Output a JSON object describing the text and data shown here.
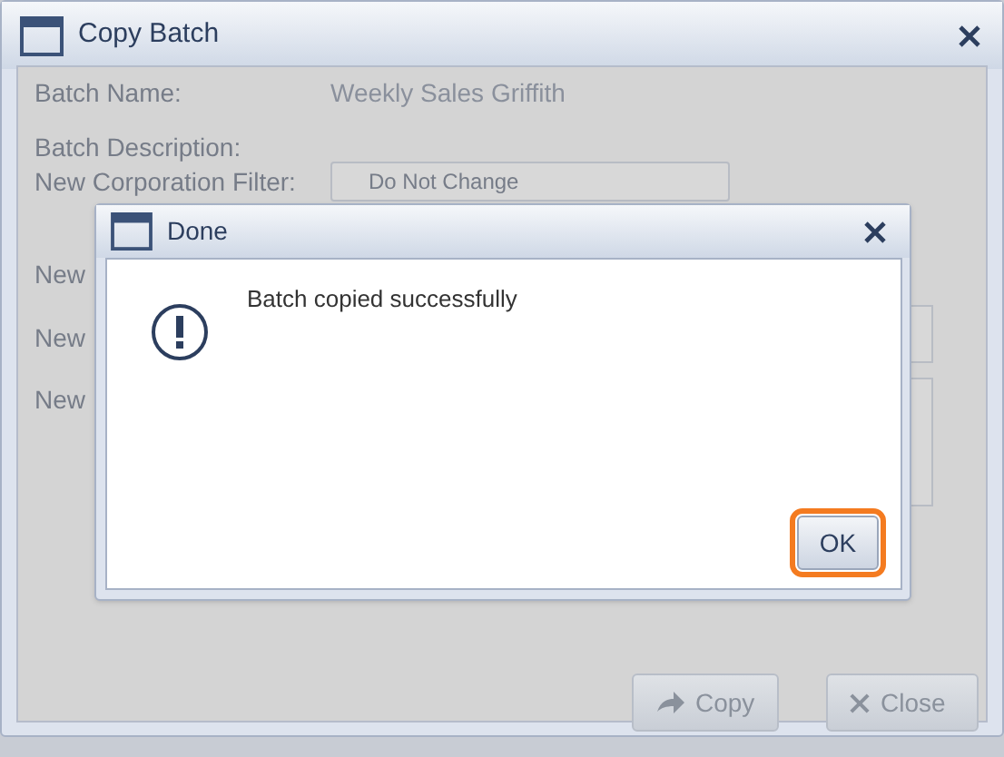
{
  "window": {
    "title": "Copy Batch"
  },
  "fields": [
    {
      "label": "Batch Name:",
      "value": "Weekly Sales Griffith"
    },
    {
      "label": "Batch Description:"
    },
    {
      "label": "New Corporation Filter:",
      "dropdown": "Do Not Change"
    },
    {
      "label": "New"
    },
    {
      "label": "New"
    },
    {
      "label": "New"
    }
  ],
  "buttons": [
    {
      "kind": "copy",
      "label": "Copy",
      "disabled": true
    },
    {
      "kind": "close",
      "label": "Close",
      "disabled": true
    }
  ],
  "dialog": {
    "title": "Done",
    "message": "Batch copied successfully",
    "button": {
      "label": "OK",
      "focused": true
    }
  }
}
